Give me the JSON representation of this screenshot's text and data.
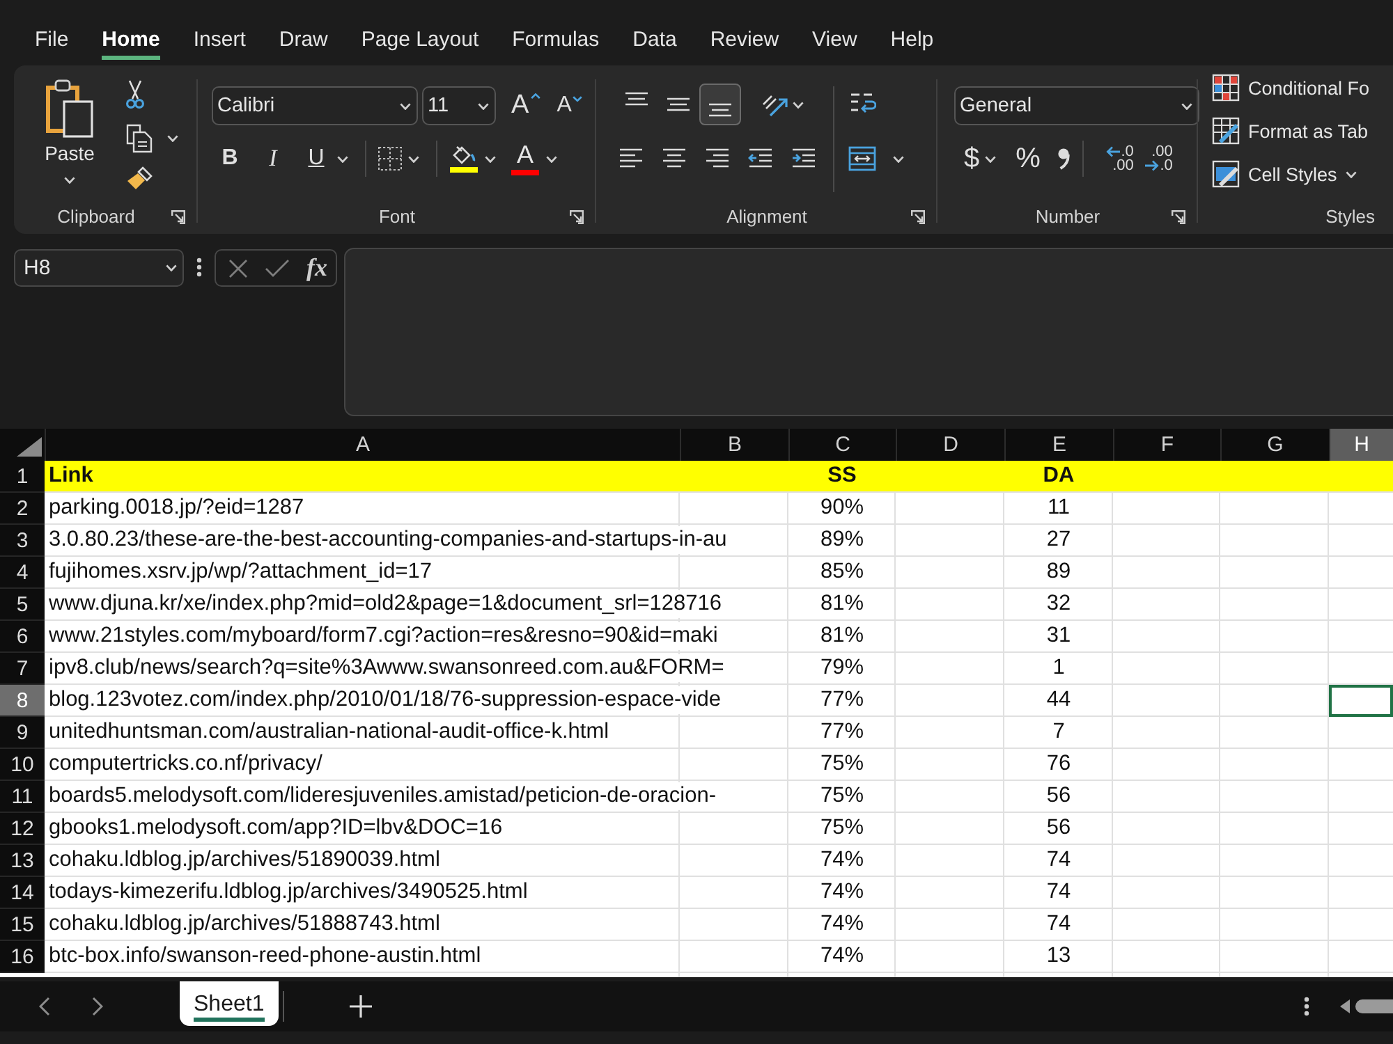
{
  "menu_tabs": [
    {
      "label": "File",
      "selected": false
    },
    {
      "label": "Home",
      "selected": true
    },
    {
      "label": "Insert",
      "selected": false
    },
    {
      "label": "Draw",
      "selected": false
    },
    {
      "label": "Page Layout",
      "selected": false
    },
    {
      "label": "Formulas",
      "selected": false
    },
    {
      "label": "Data",
      "selected": false
    },
    {
      "label": "Review",
      "selected": false
    },
    {
      "label": "View",
      "selected": false
    },
    {
      "label": "Help",
      "selected": false
    }
  ],
  "ribbon": {
    "clipboard": {
      "paste_label": "Paste",
      "group_label": "Clipboard"
    },
    "font": {
      "font_name": "Calibri",
      "font_size": "11",
      "grow_glyph": "A",
      "shrink_glyph": "A",
      "bold_glyph": "B",
      "italic_glyph": "I",
      "underline_glyph": "U",
      "color_buttons": [
        {
          "kind": "fill",
          "color": "#ffff00"
        },
        {
          "kind": "text",
          "glyph": "A",
          "color": "#ff0000"
        }
      ],
      "group_label": "Font"
    },
    "alignment": {
      "vertical_align": [
        {
          "kind": "top",
          "selected": false
        },
        {
          "kind": "middle",
          "selected": false
        },
        {
          "kind": "bottom",
          "selected": true
        }
      ],
      "group_label": "Alignment"
    },
    "number": {
      "format": "General",
      "currency_glyph": "$",
      "percent_glyph": "%",
      "decimal_buttons": [
        {
          "kind": "increase",
          "top": ".0",
          "bottom": ".00"
        },
        {
          "kind": "decrease",
          "top": ".00",
          "bottom": ".0"
        }
      ],
      "group_label": "Number"
    },
    "styles": {
      "items": [
        {
          "kind": "conditional",
          "label": "Conditional Fo",
          "caret": false
        },
        {
          "kind": "table",
          "label": "Format as Tab",
          "caret": false
        },
        {
          "kind": "cell",
          "label": "Cell Styles",
          "caret": true
        }
      ],
      "group_label": "Styles"
    }
  },
  "formula_bar": {
    "name_box": "H8",
    "function_label": "fx"
  },
  "sheet": {
    "columns": [
      {
        "label": "A",
        "selected": false
      },
      {
        "label": "B",
        "selected": false
      },
      {
        "label": "C",
        "selected": false
      },
      {
        "label": "D",
        "selected": false
      },
      {
        "label": "E",
        "selected": false
      },
      {
        "label": "F",
        "selected": false
      },
      {
        "label": "G",
        "selected": false
      },
      {
        "label": "H",
        "selected": true
      }
    ],
    "rows": [
      {
        "number": "1",
        "selected": false,
        "kind": "header",
        "link": "Link",
        "ss": "SS",
        "da": "DA"
      },
      {
        "number": "2",
        "selected": false,
        "kind": "data",
        "link": "parking.0018.jp/?eid=1287",
        "ss": "90%",
        "da": "11"
      },
      {
        "number": "3",
        "selected": false,
        "kind": "data",
        "link": "3.0.80.23/these-are-the-best-accounting-companies-and-startups-in-au",
        "ss": "89%",
        "da": "27"
      },
      {
        "number": "4",
        "selected": false,
        "kind": "data",
        "link": "fujihomes.xsrv.jp/wp/?attachment_id=17",
        "ss": "85%",
        "da": "89"
      },
      {
        "number": "5",
        "selected": false,
        "kind": "data",
        "link": "www.djuna.kr/xe/index.php?mid=old2&page=1&document_srl=128716",
        "ss": "81%",
        "da": "32"
      },
      {
        "number": "6",
        "selected": false,
        "kind": "data",
        "link": "www.21styles.com/myboard/form7.cgi?action=res&resno=90&id=maki",
        "ss": "81%",
        "da": "31"
      },
      {
        "number": "7",
        "selected": false,
        "kind": "data",
        "link": "ipv8.club/news/search?q=site%3Awww.swansonreed.com.au&FORM=",
        "ss": "79%",
        "da": "1"
      },
      {
        "number": "8",
        "selected": true,
        "kind": "data",
        "link": "blog.123votez.com/index.php/2010/01/18/76-suppression-espace-vide",
        "ss": "77%",
        "da": "44"
      },
      {
        "number": "9",
        "selected": false,
        "kind": "data",
        "link": "unitedhuntsman.com/australian-national-audit-office-k.html",
        "ss": "77%",
        "da": "7"
      },
      {
        "number": "10",
        "selected": false,
        "kind": "data",
        "link": "computertricks.co.nf/privacy/",
        "ss": "75%",
        "da": "76"
      },
      {
        "number": "11",
        "selected": false,
        "kind": "data",
        "link": "boards5.melodysoft.com/lideresjuveniles.amistad/peticion-de-oracion-",
        "ss": "75%",
        "da": "56"
      },
      {
        "number": "12",
        "selected": false,
        "kind": "data",
        "link": "gbooks1.melodysoft.com/app?ID=lbv&DOC=16",
        "ss": "75%",
        "da": "56"
      },
      {
        "number": "13",
        "selected": false,
        "kind": "data",
        "link": "cohaku.ldblog.jp/archives/51890039.html",
        "ss": "74%",
        "da": "74"
      },
      {
        "number": "14",
        "selected": false,
        "kind": "data",
        "link": "todays-kimezerifu.ldblog.jp/archives/3490525.html",
        "ss": "74%",
        "da": "74"
      },
      {
        "number": "15",
        "selected": false,
        "kind": "data",
        "link": "cohaku.ldblog.jp/archives/51888743.html",
        "ss": "74%",
        "da": "74"
      },
      {
        "number": "16",
        "selected": false,
        "kind": "data",
        "link": "btc-box.info/swanson-reed-phone-austin.html",
        "ss": "74%",
        "da": "13"
      }
    ]
  },
  "sheet_tabs": [
    {
      "label": "Sheet1",
      "selected": true
    }
  ]
}
